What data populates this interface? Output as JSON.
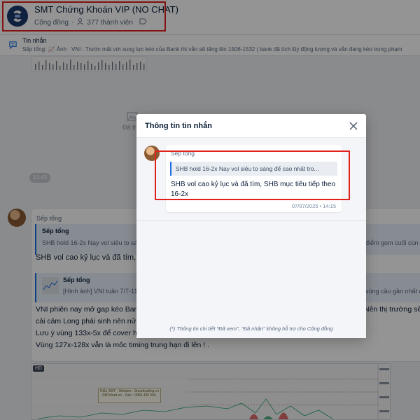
{
  "header": {
    "group_name": "SMT Chứng Khoán VIP (NO CHAT)",
    "community_label": "Cộng đồng",
    "members": "377 thành viên"
  },
  "pinned": {
    "title": "Tin nhắn",
    "preview": "Sếp tổng: 📈 Ảnh · VNI : Trước mắt với xung lực kéo của Bank thì vẫn sẽ tăng lên 1506-1532 ( bank đã tích lũy động lượng và vẫn đang kéo trong phạm"
  },
  "chat": {
    "photo_label": "Đã th",
    "time_chip": "13:43",
    "message": {
      "sender": "Sếp tổng",
      "quote_sender": "Sếp tổng",
      "quote_text": "SHB hold 16-2x Nay vol siêu to sáng",
      "quote_right": "điểm gom cuối cùn",
      "text": "SHB vol cao kỷ lục và đã tím, SHB",
      "quote2_sender": "Sếp tổng",
      "quote2_text": "[Hình ảnh] VNI tuần 7/7-11/7",
      "quote2_right": "vùng cầu gần nhất c",
      "lines": [
        "VNI phiên nay mở gap kéo Bank,",
        "cải câm Long phải sinh nên nửa c",
        "Lưu ý vùng 133x-5x để cover hàng",
        "Vùng 127x-128x vẫn là mốc timing trung hạn đi lên ! ."
      ],
      "right_lines": [
        "Nên thị trường sẽ"
      ],
      "chart_badge": "HD",
      "chart_note": "Hiểu SMT · Website : Smarttrading.vn · SMTchart.vn · Zalo : 0969 435 504"
    }
  },
  "modal": {
    "title": "Thông tin tin nhắn",
    "sender": "Sếp tổng",
    "quote": "SHB hold 16-2x Nay vol siêu to sáng để cao nhất tro...",
    "text": "SHB vol cao kỷ lục và đã tím, SHB mục tiêu tiếp theo 16-2x",
    "timestamp": "07/07/2025 • 14:15",
    "footnote": "(*) Thông tin chi tiết \"Đã xem\", \"Đã nhận\" không hỗ trợ cho Cộng đồng"
  },
  "icons": {
    "group_avatar": "smt-logo-icon",
    "members": "people-icon",
    "tag": "tag-icon",
    "pinned": "message-icon",
    "close": "close-icon",
    "photo": "image-icon"
  },
  "colors": {
    "highlight": "#e0201b",
    "accent": "#1b6ee6",
    "logo": "#1d3a6e"
  }
}
